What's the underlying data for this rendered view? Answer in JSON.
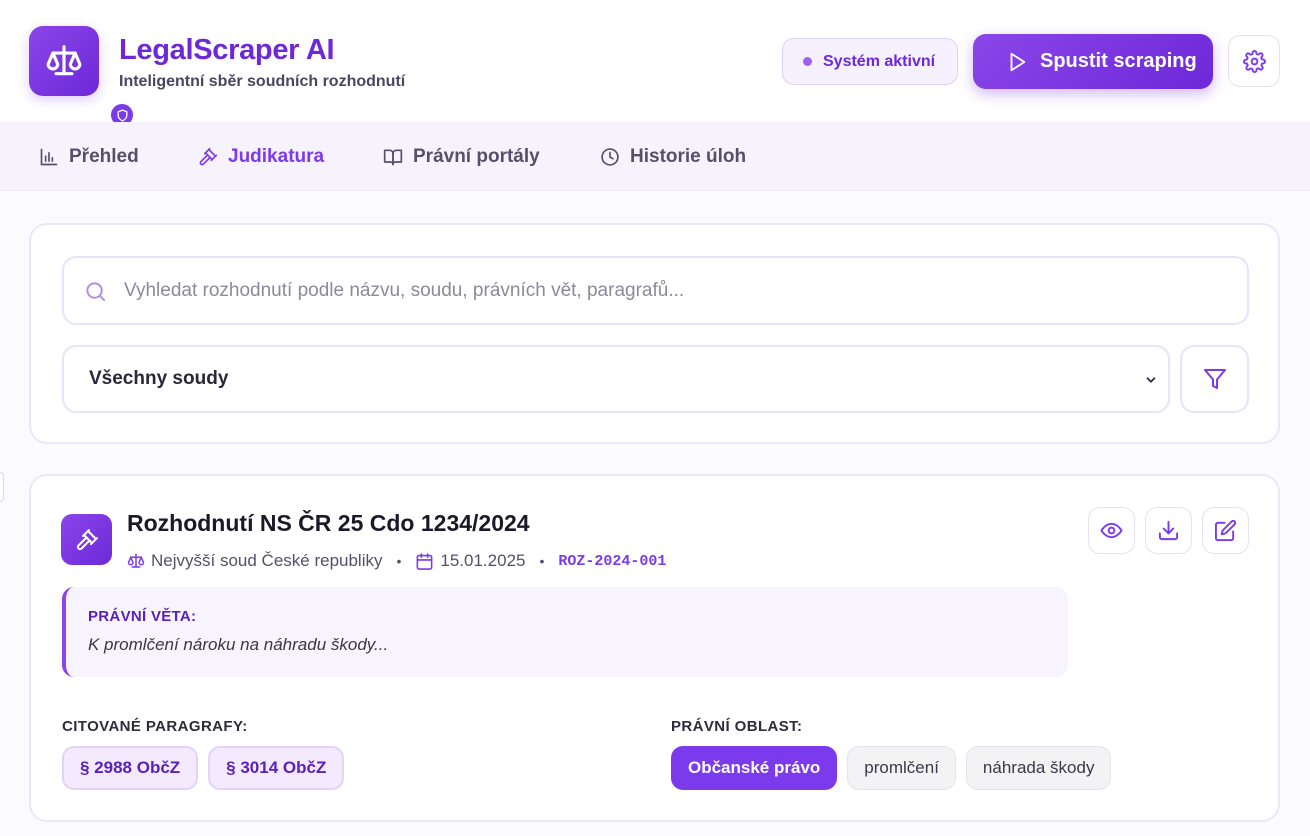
{
  "app": {
    "title": "LegalScraper AI",
    "subtitle": "Inteligentní sběr soudních rozhodnutí"
  },
  "header": {
    "status_label": "Systém aktivní",
    "run_label": "Spustit scraping"
  },
  "nav": {
    "items": [
      {
        "label": "Přehled",
        "icon": "bar-chart-icon",
        "active": false
      },
      {
        "label": "Judikatura",
        "icon": "gavel-icon",
        "active": true
      },
      {
        "label": "Právní portály",
        "icon": "book-icon",
        "active": false
      },
      {
        "label": "Historie úloh",
        "icon": "clock-icon",
        "active": false
      }
    ]
  },
  "search": {
    "placeholder": "Vyhledat rozhodnutí podle názvu, soudu, právních vět, paragrafů...",
    "value": "",
    "court_selected": "Všechny soudy"
  },
  "decision": {
    "title": "Rozhodnutí NS ČR 25 Cdo 1234/2024",
    "court": "Nejvyšší soud České republiky",
    "date": "15.01.2025",
    "id": "ROZ-2024-001",
    "legal_sentence_label": "PRÁVNÍ VĚTA:",
    "legal_sentence": "K promlčení nároku na náhradu škody...",
    "paragraphs_label": "CITOVANÉ PARAGRAFY:",
    "paragraphs": [
      "§ 2988 ObčZ",
      "§ 3014 ObčZ"
    ],
    "area_label": "PRÁVNÍ OBLAST:",
    "area_main": "Občanské právo",
    "area_tags": [
      "promlčení",
      "náhrada škody"
    ]
  },
  "colors": {
    "accent": "#7c3aed",
    "accent_dark": "#6d28d9",
    "background": "#fbfaff"
  }
}
